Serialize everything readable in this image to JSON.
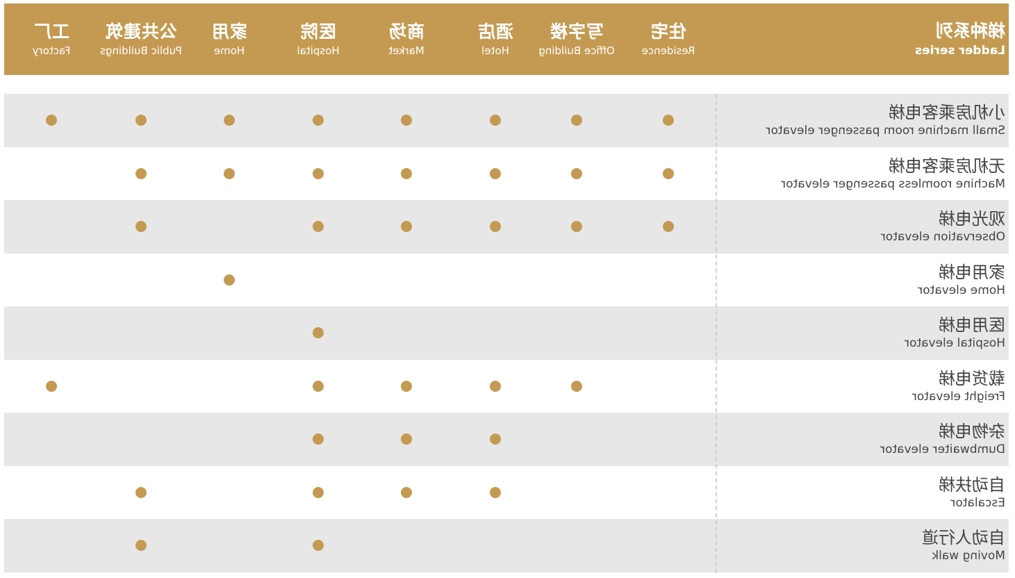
{
  "header": {
    "series_zh": "梯种系列",
    "series_en": "Ladder series",
    "columns": [
      {
        "zh": "住宅",
        "en": "Residence"
      },
      {
        "zh": "写字楼",
        "en": "Office Building"
      },
      {
        "zh": "酒店",
        "en": "Hotel"
      },
      {
        "zh": "商场",
        "en": "Market"
      },
      {
        "zh": "医院",
        "en": "Hospital"
      },
      {
        "zh": "家用",
        "en": "Home"
      },
      {
        "zh": "公共建筑",
        "en": "Public Buildings"
      },
      {
        "zh": "工厂",
        "en": "Factory"
      }
    ]
  },
  "colors": {
    "accent": "#c49a52",
    "row_shade": "#e7e7e7",
    "text": "#444444"
  },
  "rows": [
    {
      "zh": "小机房乘客电梯",
      "en": "Small machine room passenger elevator",
      "marks": [
        1,
        1,
        1,
        1,
        1,
        1,
        1,
        1
      ]
    },
    {
      "zh": "无机房乘客电梯",
      "en": "Machine roomless passenger elevator",
      "marks": [
        1,
        1,
        1,
        1,
        1,
        1,
        1,
        0
      ]
    },
    {
      "zh": "观光电梯",
      "en": "Observation elevator",
      "marks": [
        1,
        1,
        1,
        1,
        1,
        0,
        1,
        0
      ]
    },
    {
      "zh": "家用电梯",
      "en": "Home elevator",
      "marks": [
        0,
        0,
        0,
        0,
        0,
        1,
        0,
        0
      ]
    },
    {
      "zh": "医用电梯",
      "en": "Hospital elevator",
      "marks": [
        0,
        0,
        0,
        0,
        1,
        0,
        0,
        0
      ]
    },
    {
      "zh": "载货电梯",
      "en": "Freight elevator",
      "marks": [
        0,
        1,
        1,
        1,
        1,
        0,
        0,
        1
      ]
    },
    {
      "zh": "杂物电梯",
      "en": "Dumbwaiter elevator",
      "marks": [
        0,
        0,
        1,
        1,
        1,
        0,
        0,
        0
      ]
    },
    {
      "zh": "自动扶梯",
      "en": "Escalator",
      "marks": [
        0,
        0,
        1,
        1,
        1,
        0,
        1,
        0
      ]
    },
    {
      "zh": "自动人行道",
      "en": "Moving walk",
      "marks": [
        0,
        0,
        0,
        0,
        1,
        0,
        1,
        0
      ]
    }
  ]
}
